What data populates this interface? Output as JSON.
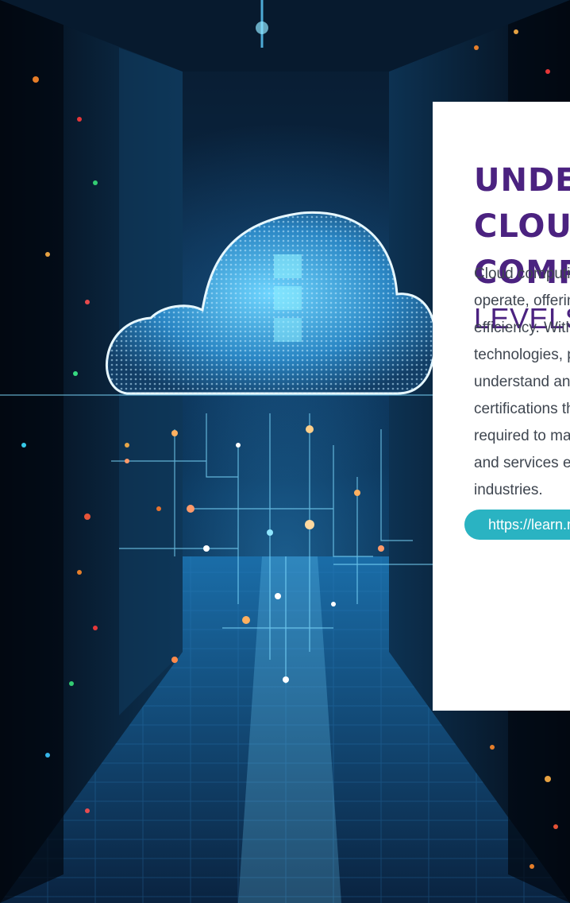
{
  "card": {
    "heading_line1": "UNDERSTANDING CLOUD",
    "heading_line2": "COMPUTING:",
    "heading_line3": "LEVELS OF CERTIFICATION",
    "body": "Cloud computing has transformed how organizations operate, offering scalability, flexibility, and cost efficiency. With the widespread adoption of cloud technologies, professionals are increasingly seeking to understand and validate their skills through certifications that provide learners with the knowledge required to manage cloud platforms, infrastructure, and services effectively across a wide range of industries.",
    "url": "https://learn.microsoft.com/credentials"
  },
  "colors": {
    "heading": "#4b2280",
    "body_text": "#3f4650",
    "pill_background": "#2ab3c2",
    "pill_text": "#ffffff",
    "card_background": "#ffffff"
  },
  "icons": {
    "hero": "cloud-icon"
  }
}
